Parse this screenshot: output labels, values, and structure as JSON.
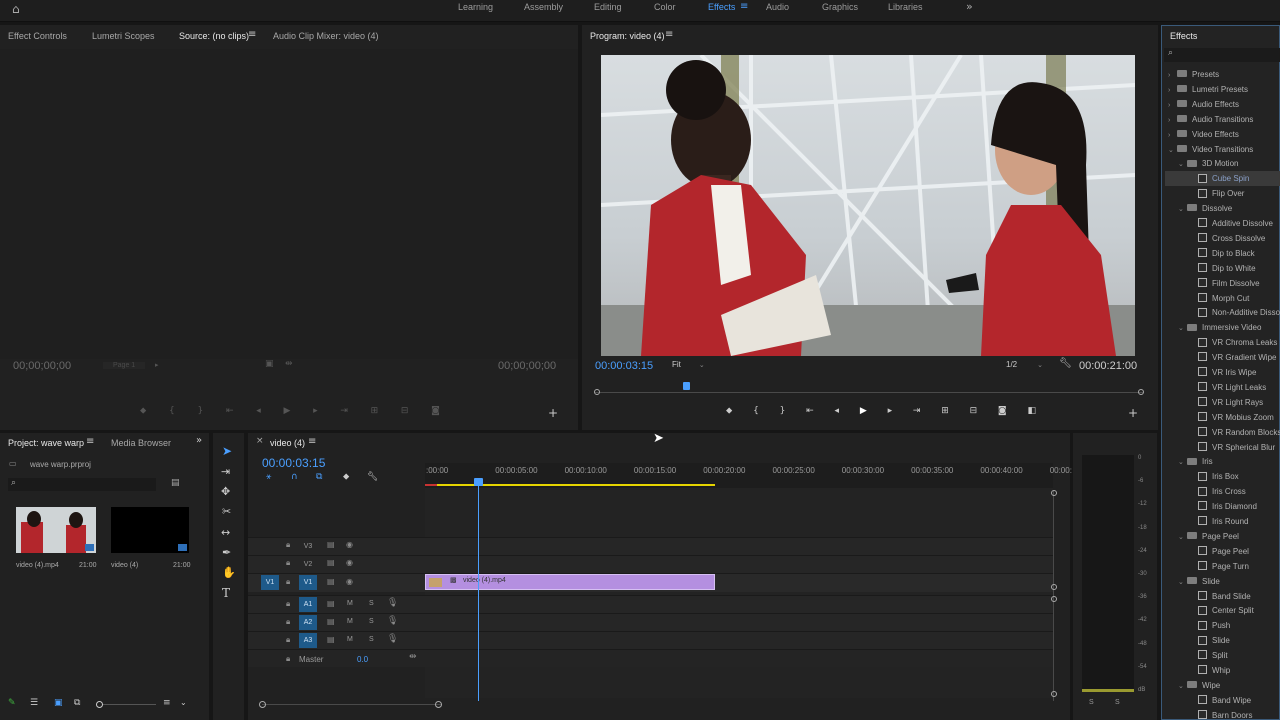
{
  "workspaces": [
    "Learning",
    "Assembly",
    "Editing",
    "Color",
    "Effects",
    "Audio",
    "Graphics",
    "Libraries"
  ],
  "active_workspace": "Effects",
  "source_panel": {
    "tabs": [
      "Effect Controls",
      "Lumetri Scopes",
      "Source: (no clips)",
      "Audio Clip Mixer: video (4)"
    ],
    "active_tab": "Source: (no clips)",
    "timecode_left": "00;00;00;00",
    "timecode_right": "00;00;00;00",
    "page_label": "Page 1"
  },
  "program_panel": {
    "title": "Program: video (4)",
    "timecode": "00:00:03:15",
    "fit": "Fit",
    "resolution": "1/2",
    "duration": "00:00:21:00",
    "playhead_progress": 0.16
  },
  "effects_panel": {
    "title": "Effects",
    "search_placeholder": "",
    "tree": [
      {
        "type": "folder",
        "label": "Presets",
        "level": 0,
        "expanded": false
      },
      {
        "type": "folder",
        "label": "Lumetri Presets",
        "level": 0,
        "expanded": false
      },
      {
        "type": "folder",
        "label": "Audio Effects",
        "level": 0,
        "expanded": false
      },
      {
        "type": "folder",
        "label": "Audio Transitions",
        "level": 0,
        "expanded": false
      },
      {
        "type": "folder",
        "label": "Video Effects",
        "level": 0,
        "expanded": false
      },
      {
        "type": "folder",
        "label": "Video Transitions",
        "level": 0,
        "expanded": true
      },
      {
        "type": "folder",
        "label": "3D Motion",
        "level": 1,
        "expanded": true
      },
      {
        "type": "fx",
        "label": "Cube Spin",
        "level": 2,
        "selected": true
      },
      {
        "type": "fx",
        "label": "Flip Over",
        "level": 2
      },
      {
        "type": "folder",
        "label": "Dissolve",
        "level": 1,
        "expanded": true
      },
      {
        "type": "fx",
        "label": "Additive Dissolve",
        "level": 2
      },
      {
        "type": "fx",
        "label": "Cross Dissolve",
        "level": 2
      },
      {
        "type": "fx",
        "label": "Dip to Black",
        "level": 2
      },
      {
        "type": "fx",
        "label": "Dip to White",
        "level": 2
      },
      {
        "type": "fx",
        "label": "Film Dissolve",
        "level": 2
      },
      {
        "type": "fx",
        "label": "Morph Cut",
        "level": 2
      },
      {
        "type": "fx",
        "label": "Non-Additive Dissolve",
        "level": 2
      },
      {
        "type": "folder",
        "label": "Immersive Video",
        "level": 1,
        "expanded": true
      },
      {
        "type": "fx",
        "label": "VR Chroma Leaks",
        "level": 2
      },
      {
        "type": "fx",
        "label": "VR Gradient Wipe",
        "level": 2
      },
      {
        "type": "fx",
        "label": "VR Iris Wipe",
        "level": 2
      },
      {
        "type": "fx",
        "label": "VR Light Leaks",
        "level": 2
      },
      {
        "type": "fx",
        "label": "VR Light Rays",
        "level": 2
      },
      {
        "type": "fx",
        "label": "VR Mobius Zoom",
        "level": 2
      },
      {
        "type": "fx",
        "label": "VR Random Blocks",
        "level": 2
      },
      {
        "type": "fx",
        "label": "VR Spherical Blur",
        "level": 2
      },
      {
        "type": "folder",
        "label": "Iris",
        "level": 1,
        "expanded": true
      },
      {
        "type": "fx",
        "label": "Iris Box",
        "level": 2
      },
      {
        "type": "fx",
        "label": "Iris Cross",
        "level": 2
      },
      {
        "type": "fx",
        "label": "Iris Diamond",
        "level": 2
      },
      {
        "type": "fx",
        "label": "Iris Round",
        "level": 2
      },
      {
        "type": "folder",
        "label": "Page Peel",
        "level": 1,
        "expanded": true
      },
      {
        "type": "fx",
        "label": "Page Peel",
        "level": 2
      },
      {
        "type": "fx",
        "label": "Page Turn",
        "level": 2
      },
      {
        "type": "folder",
        "label": "Slide",
        "level": 1,
        "expanded": true
      },
      {
        "type": "fx",
        "label": "Band Slide",
        "level": 2
      },
      {
        "type": "fx",
        "label": "Center Split",
        "level": 2
      },
      {
        "type": "fx",
        "label": "Push",
        "level": 2
      },
      {
        "type": "fx",
        "label": "Slide",
        "level": 2
      },
      {
        "type": "fx",
        "label": "Split",
        "level": 2
      },
      {
        "type": "fx",
        "label": "Whip",
        "level": 2
      },
      {
        "type": "folder",
        "label": "Wipe",
        "level": 1,
        "expanded": true
      },
      {
        "type": "fx",
        "label": "Band Wipe",
        "level": 2
      },
      {
        "type": "fx",
        "label": "Barn Doors",
        "level": 2
      }
    ]
  },
  "project_panel": {
    "tabs": [
      "Project: wave warp",
      "Media Browser"
    ],
    "active_tab": "Project: wave warp",
    "file": "wave warp.prproj",
    "items": [
      {
        "name": "video (4).mp4",
        "duration": "21:00"
      },
      {
        "name": "video (4)",
        "duration": "21:00"
      }
    ]
  },
  "timeline_panel": {
    "title": "video (4)",
    "timecode": "00:00:03:15",
    "ruler": [
      ":00:00",
      "00:00:05:00",
      "00:00:10:00",
      "00:00:15:00",
      "00:00:20:00",
      "00:00:25:00",
      "00:00:30:00",
      "00:00:35:00",
      "00:00:40:00",
      "00:00:"
    ],
    "video_tracks": [
      "V3",
      "V2",
      "V1"
    ],
    "audio_tracks": [
      "A1",
      "A2",
      "A3"
    ],
    "source_target": "V1",
    "clip_name": "video (4).mp4",
    "master_label": "Master",
    "master_value": "0.0",
    "m_label": "M",
    "s_label": "S"
  },
  "audio_meter": {
    "scale": [
      "0",
      "-6",
      "-12",
      "-18",
      "-24",
      "-30",
      "-36",
      "-42",
      "-48",
      "-54",
      "dB"
    ],
    "solo": [
      "S",
      "S"
    ]
  },
  "colors": {
    "accent": "#4a9fff",
    "clip": "#b48fe0",
    "target": "#1e5a8a"
  }
}
